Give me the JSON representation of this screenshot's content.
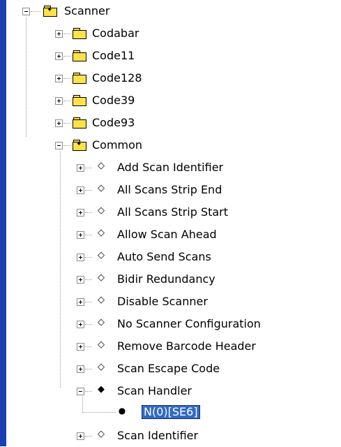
{
  "tree": {
    "root": {
      "label": "Scanner",
      "icon": "open-folder-icon"
    },
    "folders": [
      {
        "label": "Codabar"
      },
      {
        "label": "Code11"
      },
      {
        "label": "Code128"
      },
      {
        "label": "Code39"
      },
      {
        "label": "Code93"
      }
    ],
    "common": {
      "label": "Common",
      "icon": "open-folder-icon"
    },
    "items": [
      {
        "label": "Add Scan Identifier"
      },
      {
        "label": "All Scans Strip End"
      },
      {
        "label": "All Scans Strip Start"
      },
      {
        "label": "Allow Scan Ahead"
      },
      {
        "label": "Auto Send Scans"
      },
      {
        "label": "Bidir Redundancy"
      },
      {
        "label": "Disable Scanner"
      },
      {
        "label": "No Scanner Configuration"
      },
      {
        "label": "Remove Barcode Header"
      },
      {
        "label": "Scan Escape Code"
      }
    ],
    "expanded_item": {
      "label": "Scan Handler"
    },
    "selected_value": {
      "label": "N(0)[SE6]"
    },
    "last_item": {
      "label": "Scan Identifier"
    }
  },
  "colors": {
    "accent_bar": "#1a3fb0",
    "selection": "#316ac5",
    "folder": "#ffe24a"
  }
}
